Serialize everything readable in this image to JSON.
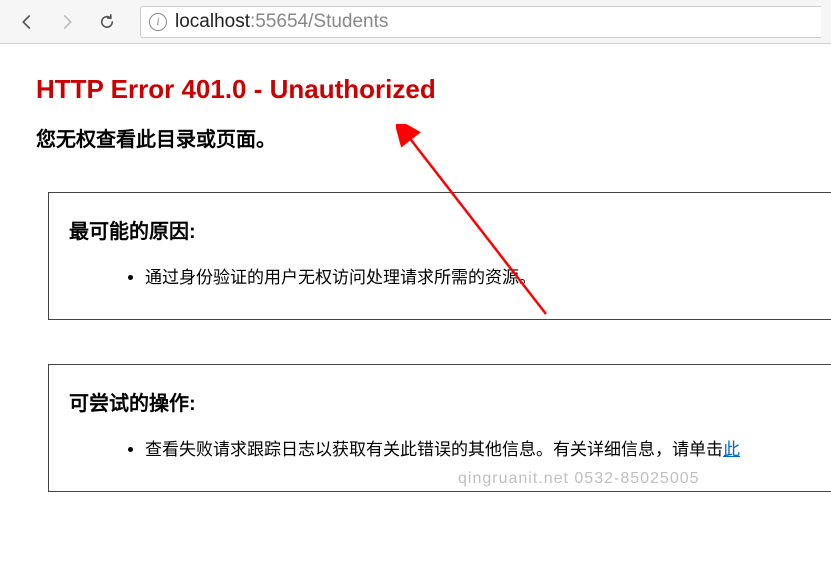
{
  "browser": {
    "url_host": "localhost",
    "url_port_path": ":55654/Students",
    "info_icon_char": "i"
  },
  "error": {
    "title": "HTTP Error 401.0 - Unauthorized",
    "subtitle": "您无权查看此目录或页面。"
  },
  "section1": {
    "title": "最可能的原因:",
    "item": "通过身份验证的用户无权访问处理请求所需的资源。"
  },
  "section2": {
    "title": "可尝试的操作:",
    "item_text": "查看失败请求跟踪日志以获取有关此错误的其他信息。有关详细信息，请单击",
    "item_link": "此"
  },
  "watermark": "qingruanit.net 0532-85025005"
}
